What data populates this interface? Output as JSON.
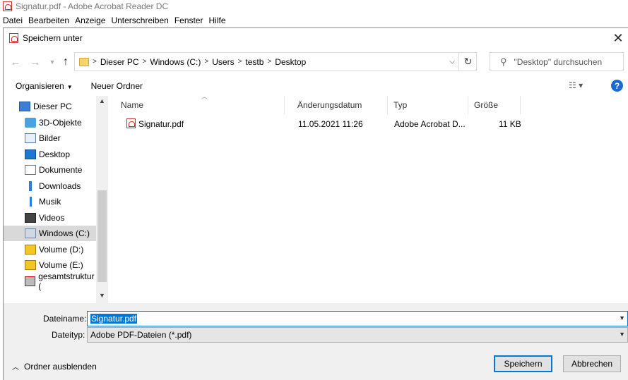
{
  "app": {
    "title": "Signatur.pdf - Adobe Acrobat Reader DC",
    "menu": [
      "Datei",
      "Bearbeiten",
      "Anzeige",
      "Unterschreiben",
      "Fenster",
      "Hilfe"
    ]
  },
  "dialog": {
    "title": "Speichern unter",
    "address": {
      "crumbs": [
        "Dieser PC",
        "Windows (C:)",
        "Users",
        "testb",
        "Desktop"
      ]
    },
    "search": {
      "placeholder": "\"Desktop\" durchsuchen"
    },
    "toolbar": {
      "organize": "Organisieren",
      "new_folder": "Neuer Ordner"
    },
    "nav": [
      {
        "label": "Dieser PC",
        "icon": "computer-icon",
        "indent": 0,
        "selected": false
      },
      {
        "label": "3D-Objekte",
        "icon": "3d-objects-icon",
        "indent": 1,
        "selected": false
      },
      {
        "label": "Bilder",
        "icon": "pictures-icon",
        "indent": 1,
        "selected": false
      },
      {
        "label": "Desktop",
        "icon": "desktop-icon",
        "indent": 1,
        "selected": false
      },
      {
        "label": "Dokumente",
        "icon": "documents-icon",
        "indent": 1,
        "selected": false
      },
      {
        "label": "Downloads",
        "icon": "downloads-icon",
        "indent": 1,
        "selected": false
      },
      {
        "label": "Musik",
        "icon": "music-icon",
        "indent": 1,
        "selected": false
      },
      {
        "label": "Videos",
        "icon": "videos-icon",
        "indent": 1,
        "selected": false
      },
      {
        "label": "Windows (C:)",
        "icon": "drive-icon",
        "indent": 1,
        "selected": true
      },
      {
        "label": "Volume (D:)",
        "icon": "drive-warning-icon",
        "indent": 1,
        "selected": false
      },
      {
        "label": "Volume (E:)",
        "icon": "drive-warning-icon",
        "indent": 1,
        "selected": false
      },
      {
        "label": "gesamtstruktur (",
        "icon": "network-drive-disconnected-icon",
        "indent": 1,
        "selected": false
      }
    ],
    "columns": [
      "Name",
      "Änderungsdatum",
      "Typ",
      "Größe"
    ],
    "files": [
      {
        "name": "Signatur.pdf",
        "modified": "11.05.2021 11:26",
        "type": "Adobe Acrobat D...",
        "size": "11 KB"
      }
    ],
    "filename": {
      "label": "Dateiname:",
      "value": "Signatur.pdf"
    },
    "filetype": {
      "label": "Dateityp:",
      "value": "Adobe PDF-Dateien (*.pdf)"
    },
    "hide_folders": "Ordner ausblenden",
    "buttons": {
      "save": "Speichern",
      "cancel": "Abbrechen"
    }
  }
}
